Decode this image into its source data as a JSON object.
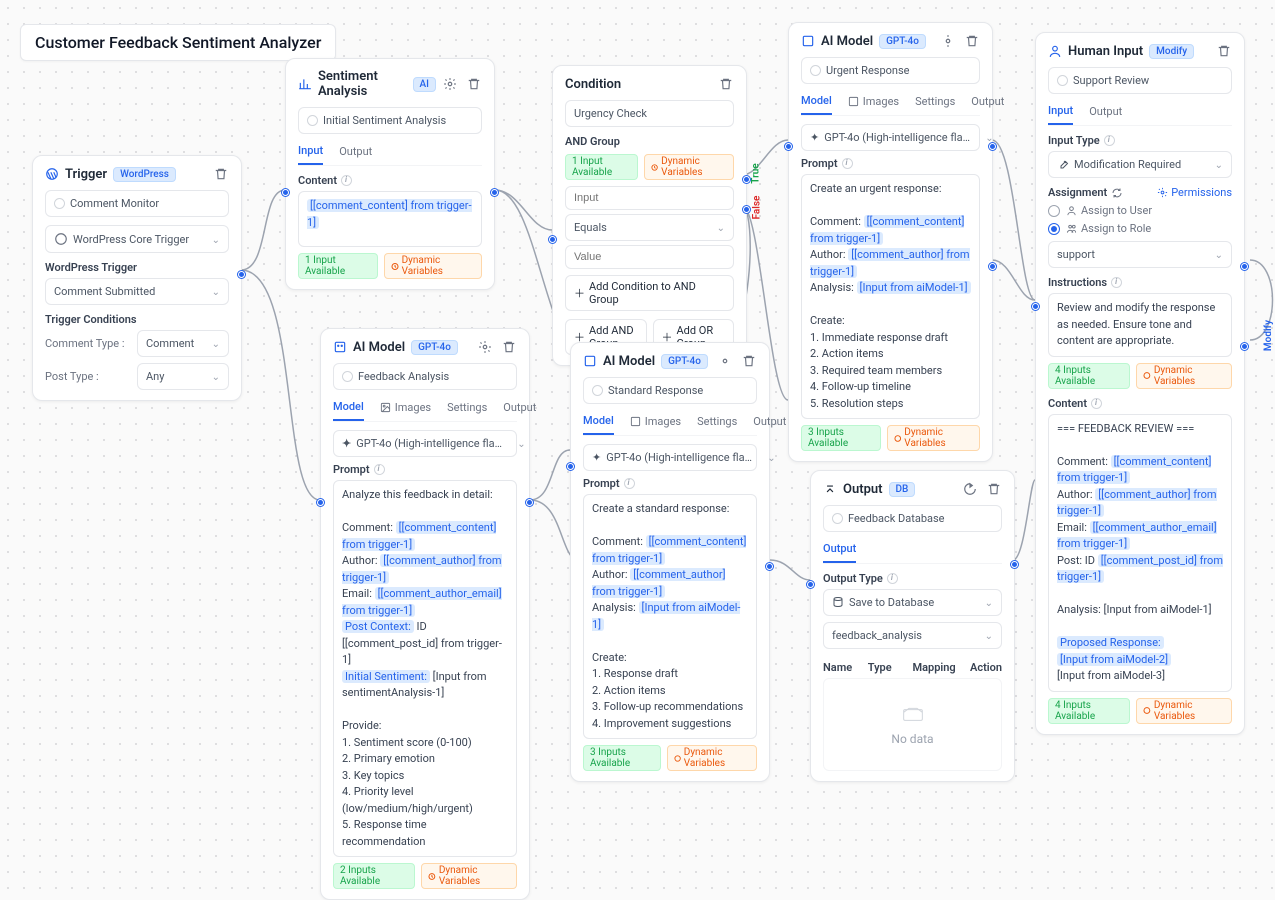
{
  "title": "Customer Feedback Sentiment Analyzer",
  "trigger": {
    "title": "Trigger",
    "badge": "WordPress",
    "comment_monitor": "Comment Monitor",
    "core_trigger": "WordPress Core Trigger",
    "wp_trigger_label": "WordPress Trigger",
    "wp_trigger_value": "Comment Submitted",
    "conditions_label": "Trigger Conditions",
    "comment_type_label": "Comment Type :",
    "comment_type_value": "Comment",
    "post_type_label": "Post Type :",
    "post_type_value": "Any"
  },
  "sentiment": {
    "title": "Sentiment Analysis",
    "badge": "AI",
    "name": "Initial Sentiment Analysis",
    "tab_input": "Input",
    "tab_output": "Output",
    "content_label": "Content",
    "content_var": "[[comment_content] from trigger-1]",
    "inputs_avail": "1 Input Available",
    "dyn_vars": "Dynamic Variables"
  },
  "feedback_ai": {
    "title": "AI Model",
    "badge": "GPT-4o",
    "name": "Feedback Analysis",
    "tab_model": "Model",
    "tab_images": "Images",
    "tab_settings": "Settings",
    "tab_output": "Output",
    "model_value": "GPT-4o (High-intelligence flagship model)...",
    "prompt_label": "Prompt",
    "prompt_l1": "Analyze this feedback in detail:",
    "prompt_c1": "Comment: ",
    "prompt_c1v": "[[comment_content] from trigger-1]",
    "prompt_c2": "Author: ",
    "prompt_c2v": "[[comment_author] from trigger-1]",
    "prompt_c3": "Email: ",
    "prompt_c3v": "[[comment_author_email] from trigger-1]",
    "prompt_c4a": "Post Context:",
    "prompt_c4b": " ID [[comment_post_id] from trigger-1]",
    "prompt_c5a": "Initial Sentiment:",
    "prompt_c5b": " [Input from sentimentAnalysis-1]",
    "prompt_provide": "Provide:",
    "prompt_p1": "1. Sentiment score (0-100)",
    "prompt_p2": "2. Primary emotion",
    "prompt_p3": "3. Key topics",
    "prompt_p4": "4. Priority level (low/medium/high/urgent)",
    "prompt_p5": "5. Response time recommendation",
    "inputs_avail": "2 Inputs Available",
    "dyn_vars": "Dynamic Variables"
  },
  "condition": {
    "title": "Condition",
    "name": "Urgency Check",
    "and_group": "AND Group",
    "input_ph": "Input",
    "equals": "Equals",
    "value_ph": "Value",
    "add_cond": "Add Condition to AND Group",
    "add_and": "Add AND Group",
    "add_or": "Add OR Group",
    "inputs_avail": "1 Input Available",
    "dyn_vars": "Dynamic Variables",
    "true_label": "True",
    "false_label": "False"
  },
  "urgent_ai": {
    "title": "AI Model",
    "badge": "GPT-4o",
    "name": "Urgent Response",
    "tab_model": "Model",
    "tab_images": "Images",
    "tab_settings": "Settings",
    "tab_output": "Output",
    "model_value": "GPT-4o (High-intelligence flagship model)...",
    "prompt_label": "Prompt",
    "p0": "Create an urgent response:",
    "p1": "Comment: ",
    "p1v": "[[comment_content] from trigger-1]",
    "p2": "Author: ",
    "p2v": "[[comment_author] from trigger-1]",
    "p3": "Analysis: ",
    "p3v": "[Input from aiModel-1]",
    "create": "Create:",
    "c1": "1. Immediate response draft",
    "c2": "2. Action items",
    "c3": "3. Required team members",
    "c4": "4. Follow-up timeline",
    "c5": "5. Resolution steps",
    "inputs_avail": "3 Inputs Available",
    "dyn_vars": "Dynamic Variables"
  },
  "standard_ai": {
    "title": "AI Model",
    "badge": "GPT-4o",
    "name": "Standard Response",
    "tab_model": "Model",
    "tab_images": "Images",
    "tab_settings": "Settings",
    "tab_output": "Output",
    "model_value": "GPT-4o (High-intelligence flagship model)...",
    "prompt_label": "Prompt",
    "p0": "Create a standard response:",
    "p1": "Comment: ",
    "p1v": "[[comment_content] from trigger-1]",
    "p2": "Author: ",
    "p2v": "[[comment_author] from trigger-1]",
    "p3": "Analysis: ",
    "p3v": "[Input from aiModel-1]",
    "create": "Create:",
    "c1": "1. Response draft",
    "c2": "2. Action items",
    "c3": "3. Follow-up recommendations",
    "c4": "4. Improvement suggestions",
    "inputs_avail": "3 Inputs Available",
    "dyn_vars": "Dynamic Variables"
  },
  "output": {
    "title": "Output",
    "badge": "DB",
    "name": "Feedback Database",
    "tab_output": "Output",
    "output_type_label": "Output Type",
    "output_type_value": "Save to Database",
    "db_value": "feedback_analysis",
    "col_name": "Name",
    "col_type": "Type",
    "col_mapping": "Mapping",
    "col_action": "Action",
    "nodata": "No data"
  },
  "human": {
    "title": "Human Input",
    "badge": "Modify",
    "name": "Support Review",
    "tab_input": "Input",
    "tab_output": "Output",
    "input_type_label": "Input Type",
    "input_type_value": "Modification Required",
    "assignment_label": "Assignment",
    "permissions": "Permissions",
    "assign_user": "Assign to User",
    "assign_role": "Assign to Role",
    "role_value": "support",
    "instructions_label": "Instructions",
    "instructions": "Review and modify the response as needed. Ensure tone and content are appropriate.",
    "inputs_avail": "4 Inputs Available",
    "dyn_vars": "Dynamic Variables",
    "content_label": "Content",
    "header": "=== FEEDBACK REVIEW ===",
    "c1": "Comment: ",
    "c1v": "[[comment_content] from trigger-1]",
    "c2": "Author: ",
    "c2v": "[[comment_author] from trigger-1]",
    "c3": "Email: ",
    "c3v": "[[comment_author_email] from trigger-1]",
    "c4": "Post: ID ",
    "c4v": "[[comment_post_id] from trigger-1]",
    "c5": "Analysis: [Input from aiModel-1]",
    "c6a": "Proposed Response:",
    "c6b": "[Input from aiModel-2]",
    "c6c": "[Input from aiModel-3]",
    "inputs_avail2": "4 Inputs Available",
    "dyn_vars2": "Dynamic Variables",
    "modify_label": "Modify"
  }
}
